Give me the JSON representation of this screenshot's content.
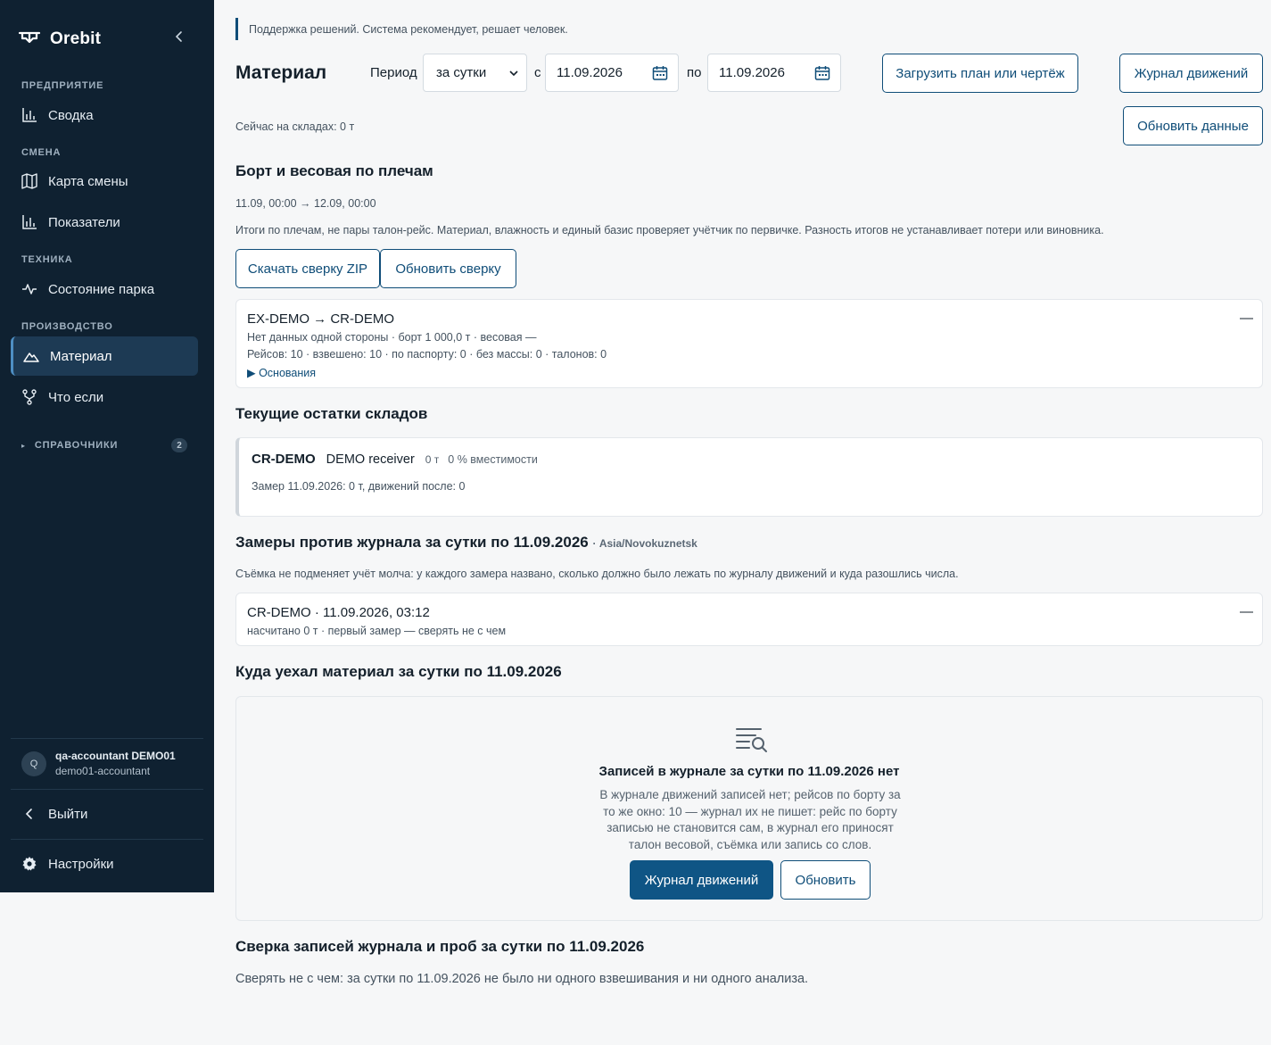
{
  "app": {
    "name": "Orebit"
  },
  "sidebar": {
    "sections": {
      "enterprise": "ПРЕДПРИЯТИЕ",
      "shift": "СМЕНА",
      "equipment": "ТЕХНИКА",
      "production": "ПРОИЗВОДСТВО"
    },
    "items": {
      "summary": "Сводка",
      "shift_map": "Карта смены",
      "indicators": "Показатели",
      "fleet": "Состояние парка",
      "material": "Материал",
      "what_if": "Что если"
    },
    "references": {
      "label": "СПРАВОЧНИКИ",
      "count": "2"
    },
    "user": {
      "initial": "Q",
      "name": "qa-accountant DEMO01",
      "role": "demo01-accountant"
    },
    "logout": "Выйти",
    "settings": "Настройки"
  },
  "header": {
    "notice": "Поддержка решений. Система рекомендует, решает человек.",
    "title": "Материал",
    "period_label": "Период",
    "period_value": "за сутки",
    "from_label": "с",
    "from_date": "11.09.2026",
    "to_label": "по",
    "to_date": "11.09.2026",
    "upload_button": "Загрузить план или чертёж",
    "journal_button": "Журнал движений",
    "refresh_button": "Обновить данные",
    "stock_now": "Сейчас на складах: 0 т"
  },
  "reconciliation": {
    "title": "Борт и весовая по плечам",
    "window": "11.09, 00:00 → 12.09, 00:00",
    "description": "Итоги по плечам, не пары талон-рейс. Материал, влажность и единый базис проверяет учётчик по первичке. Разность итогов не устанавливает потери или виновника.",
    "download_button": "Скачать сверку ZIP",
    "refresh_button": "Обновить сверку",
    "leg": {
      "title": "EX-DEMO → CR-DEMO",
      "line1": "Нет данных одной стороны · борт 1 000,0 т · весовая —",
      "line2": "Рейсов: 10 · взвешено: 10 · по паспорту: 0 · без массы: 0 · талонов: 0",
      "details": "▶ Основания",
      "dash": "—"
    }
  },
  "stocks": {
    "title": "Текущие остатки складов",
    "warehouse": {
      "code": "CR-DEMO",
      "name": "DEMO receiver",
      "qty": "0 т",
      "capacity": "0 % вместимости",
      "measurement": "Замер 11.09.2026: 0 т, движений после: 0"
    }
  },
  "measurements": {
    "title": "Замеры против журнала за сутки по 11.09.2026",
    "timezone": "· Asia/Novokuznetsk",
    "description": "Съёмка не подменяет учёт молча: у каждого замера названо, сколько должно было лежать по журналу движений и куда разошлись числа.",
    "item": {
      "title": "CR-DEMO · 11.09.2026, 03:12",
      "line": "насчитано 0 т · первый замер — сверять не с чем",
      "dash": "—"
    }
  },
  "flows": {
    "title": "Куда уехал материал за сутки по 11.09.2026",
    "empty_title": "Записей в журнале за сутки по 11.09.2026 нет",
    "empty_description": "В журнале движений записей нет; рейсов по борту за то же окно: 10 — журнал их не пишет: рейс по борту записью не становится сам, в журнал его приносят талон весовой, съёмка или запись со слов.",
    "journal_button": "Журнал движений",
    "refresh_button": "Обновить"
  },
  "samples": {
    "title": "Сверка записей журнала и проб за сутки по 11.09.2026",
    "text": "Сверять не с чем: за сутки по 11.09.2026 не было ни одного взвешивания и ни одного анализа."
  }
}
